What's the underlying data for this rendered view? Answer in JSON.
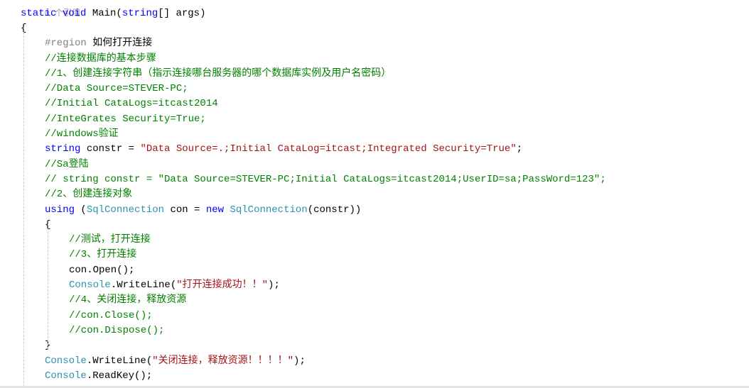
{
  "colors": {
    "keyword": "#0000ff",
    "type": "#2b91af",
    "comment": "#008000",
    "string": "#a31515",
    "region": "#808080",
    "text": "#000000",
    "codelens": "#999999"
  },
  "codelens": "0 个引用",
  "lines": [
    {
      "indent": 0,
      "tokens": [
        {
          "t": "static void ",
          "c": "keyword"
        },
        {
          "t": "Main(",
          "c": "text"
        },
        {
          "t": "string",
          "c": "keyword"
        },
        {
          "t": "[] args)",
          "c": "text"
        }
      ]
    },
    {
      "indent": 0,
      "tokens": [
        {
          "t": "{",
          "c": "text"
        }
      ]
    },
    {
      "indent": 1,
      "tokens": [
        {
          "t": "#region ",
          "c": "region"
        },
        {
          "t": "如何打开连接",
          "c": "text"
        }
      ]
    },
    {
      "indent": 1,
      "tokens": [
        {
          "t": "//连接数据库的基本步骤",
          "c": "comment"
        }
      ]
    },
    {
      "indent": 1,
      "tokens": [
        {
          "t": "//1、创建连接字符串（指示连接哪台服务器的哪个数据库实例及用户名密码）",
          "c": "comment"
        }
      ]
    },
    {
      "indent": 1,
      "tokens": [
        {
          "t": "//Data Source=STEVER-PC;",
          "c": "comment"
        }
      ]
    },
    {
      "indent": 1,
      "tokens": [
        {
          "t": "//Initial CataLogs=itcast2014",
          "c": "comment"
        }
      ]
    },
    {
      "indent": 1,
      "tokens": [
        {
          "t": "//InteGrates Security=True;",
          "c": "comment"
        }
      ]
    },
    {
      "indent": 1,
      "tokens": [
        {
          "t": "//windows验证",
          "c": "comment"
        }
      ]
    },
    {
      "indent": 1,
      "tokens": [
        {
          "t": "string",
          "c": "keyword"
        },
        {
          "t": " constr = ",
          "c": "text"
        },
        {
          "t": "\"Data Source=.;Initial CataLog=itcast;Integrated Security=True\"",
          "c": "string"
        },
        {
          "t": ";",
          "c": "text"
        }
      ]
    },
    {
      "indent": 1,
      "tokens": [
        {
          "t": "//Sa登陆",
          "c": "comment"
        }
      ]
    },
    {
      "indent": 1,
      "tokens": [
        {
          "t": "// string constr = \"Data Source=STEVER-PC;Initial CataLogs=itcast2014;UserID=sa;PassWord=123\";",
          "c": "comment"
        }
      ]
    },
    {
      "indent": 1,
      "tokens": [
        {
          "t": "//2、创建连接对象",
          "c": "comment"
        }
      ]
    },
    {
      "indent": 1,
      "tokens": [
        {
          "t": "using",
          "c": "keyword"
        },
        {
          "t": " (",
          "c": "text"
        },
        {
          "t": "SqlConnection",
          "c": "type"
        },
        {
          "t": " con = ",
          "c": "text"
        },
        {
          "t": "new ",
          "c": "keyword"
        },
        {
          "t": "SqlConnection",
          "c": "type"
        },
        {
          "t": "(constr))",
          "c": "text"
        }
      ]
    },
    {
      "indent": 1,
      "tokens": [
        {
          "t": "{",
          "c": "text"
        }
      ]
    },
    {
      "indent": 2,
      "tokens": [
        {
          "t": "//测试，打开连接",
          "c": "comment"
        }
      ]
    },
    {
      "indent": 2,
      "tokens": [
        {
          "t": "//3、打开连接",
          "c": "comment"
        }
      ]
    },
    {
      "indent": 2,
      "tokens": [
        {
          "t": "con.Open();",
          "c": "text"
        }
      ]
    },
    {
      "indent": 2,
      "tokens": [
        {
          "t": "Console",
          "c": "type"
        },
        {
          "t": ".WriteLine(",
          "c": "text"
        },
        {
          "t": "\"打开连接成功！！\"",
          "c": "string"
        },
        {
          "t": ");",
          "c": "text"
        }
      ]
    },
    {
      "indent": 2,
      "tokens": [
        {
          "t": "//4、关闭连接，释放资源",
          "c": "comment"
        }
      ]
    },
    {
      "indent": 2,
      "tokens": [
        {
          "t": "//con.Close();",
          "c": "comment"
        }
      ]
    },
    {
      "indent": 2,
      "tokens": [
        {
          "t": "//con.Dispose();",
          "c": "comment"
        }
      ]
    },
    {
      "indent": 1,
      "tokens": [
        {
          "t": "}",
          "c": "text"
        }
      ]
    },
    {
      "indent": 1,
      "tokens": [
        {
          "t": "Console",
          "c": "type"
        },
        {
          "t": ".WriteLine(",
          "c": "text"
        },
        {
          "t": "\"关闭连接，释放资源！！！！\"",
          "c": "string"
        },
        {
          "t": ");",
          "c": "text"
        }
      ]
    },
    {
      "indent": 1,
      "tokens": [
        {
          "t": "Console",
          "c": "type"
        },
        {
          "t": ".ReadKey();",
          "c": "text"
        }
      ]
    }
  ]
}
